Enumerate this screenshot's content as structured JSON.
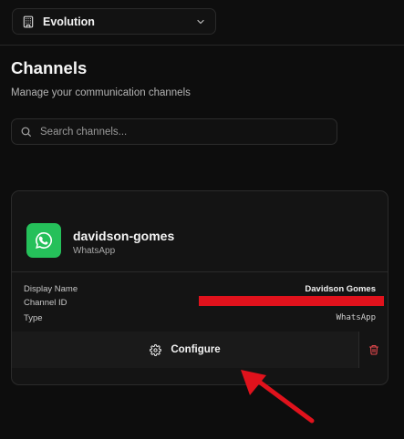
{
  "header": {
    "org_icon": "building-icon",
    "org_name": "Evolution",
    "chevron_icon": "chevron-down-icon"
  },
  "page": {
    "title": "Channels",
    "subtitle": "Manage your communication channels"
  },
  "search": {
    "icon": "search-icon",
    "placeholder": "Search channels...",
    "value": ""
  },
  "channel_card": {
    "avatar_icon": "whatsapp-icon",
    "avatar_color": "#25c05a",
    "name": "davidson-gomes",
    "type": "WhatsApp",
    "details": [
      {
        "label": "Display Name",
        "value": "Davidson Gomes"
      },
      {
        "label": "Channel ID",
        "value": ""
      },
      {
        "label": "Type",
        "value": "WhatsApp"
      }
    ],
    "redaction_color": "#e0121c",
    "configure_icon": "gear-icon",
    "configure_label": "Configure",
    "delete_icon": "trash-icon",
    "delete_color": "#e5484d"
  },
  "annotation": {
    "arrow_color": "#e0121c"
  }
}
